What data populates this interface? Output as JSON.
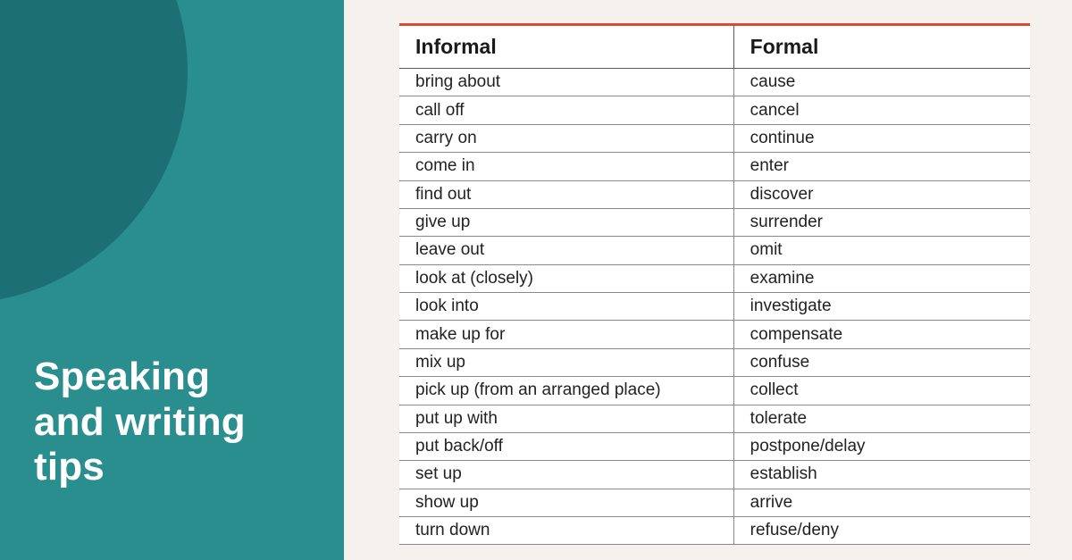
{
  "sidebar": {
    "title_line1": "Speaking",
    "title_line2": "and writing",
    "title_line3": "tips"
  },
  "table": {
    "headers": {
      "informal": "Informal",
      "formal": "Formal"
    },
    "rows": [
      {
        "informal": "bring about",
        "formal": "cause"
      },
      {
        "informal": "call off",
        "formal": "cancel"
      },
      {
        "informal": "carry on",
        "formal": "continue"
      },
      {
        "informal": "come in",
        "formal": "enter"
      },
      {
        "informal": "find out",
        "formal": "discover"
      },
      {
        "informal": "give up",
        "formal": "surrender"
      },
      {
        "informal": "leave out",
        "formal": "omit"
      },
      {
        "informal": "look at (closely)",
        "formal": "examine"
      },
      {
        "informal": "look into",
        "formal": "investigate"
      },
      {
        "informal": "make up for",
        "formal": "compensate"
      },
      {
        "informal": "mix up",
        "formal": "confuse"
      },
      {
        "informal": "pick up (from an arranged place)",
        "formal": "collect"
      },
      {
        "informal": "put up with",
        "formal": "tolerate"
      },
      {
        "informal": "put back/off",
        "formal": "postpone/delay"
      },
      {
        "informal": "set up",
        "formal": "establish"
      },
      {
        "informal": "show up",
        "formal": "arrive"
      },
      {
        "informal": "turn down",
        "formal": "refuse/deny"
      }
    ]
  }
}
